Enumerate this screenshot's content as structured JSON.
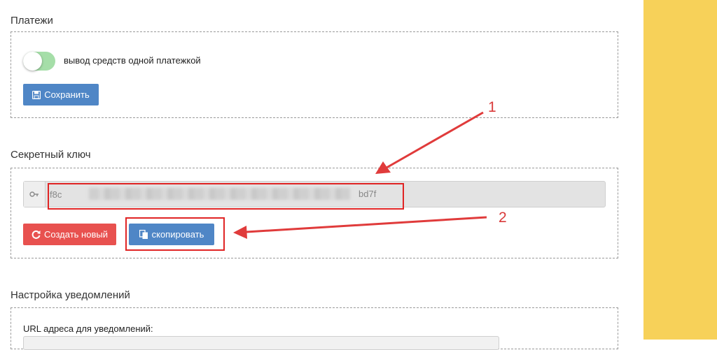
{
  "payments": {
    "title": "Платежи",
    "toggle_label": "вывод средств одной платежкой",
    "toggle_on": true,
    "save_label": "Сохранить"
  },
  "secret_key": {
    "title": "Секретный ключ",
    "value_start": "f8c",
    "value_end": "bd7f",
    "create_label": "Создать новый",
    "copy_label": "скопировать"
  },
  "notifications": {
    "title": "Настройка уведомлений",
    "url_label": "URL адреса для уведомлений:"
  },
  "annotations": {
    "label_1": "1",
    "label_2": "2"
  },
  "colors": {
    "accent_blue": "#4f86c6",
    "danger_red": "#e8514f",
    "toggle_green": "#a5dea8",
    "annotation_red": "#e02424",
    "sidebar_yellow": "#f7d159"
  },
  "icons": {
    "save": "floppy-disk-icon",
    "key": "key-icon",
    "refresh": "refresh-icon",
    "copy": "copy-icon"
  }
}
